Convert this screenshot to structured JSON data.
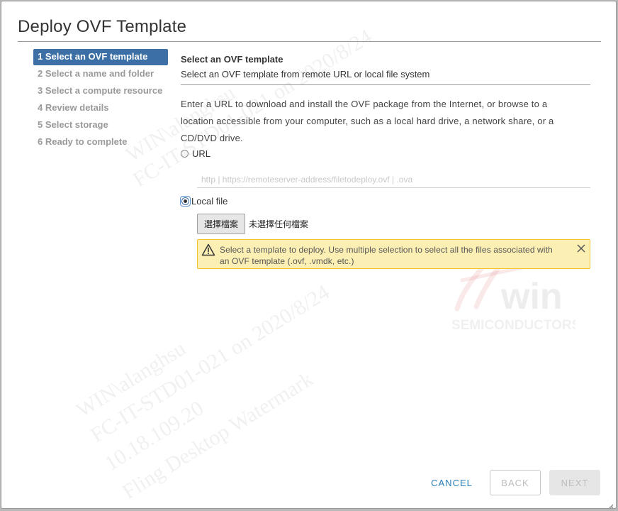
{
  "dialog": {
    "title": "Deploy OVF Template"
  },
  "steps": [
    {
      "label": "1 Select an OVF template",
      "active": true
    },
    {
      "label": "2 Select a name and folder",
      "active": false
    },
    {
      "label": "3 Select a compute resource",
      "active": false
    },
    {
      "label": "4 Review details",
      "active": false
    },
    {
      "label": "5 Select storage",
      "active": false
    },
    {
      "label": "6 Ready to complete",
      "active": false
    }
  ],
  "section": {
    "title": "Select an OVF template",
    "subtitle": "Select an OVF template from remote URL or local file system",
    "description": "Enter a URL to download and install the OVF package from the Internet, or browse to a location accessible from your computer, such as a local hard drive, a network share, or a CD/DVD drive."
  },
  "source": {
    "url_label": "URL",
    "url_placeholder": "http | https://remoteserver-address/filetodeploy.ovf | .ova",
    "url_value": "",
    "local_label": "Local file",
    "selected": "local",
    "file_button_label": "選擇檔案",
    "file_status": "未選擇任何檔案"
  },
  "alert": {
    "text": "Select a template to deploy. Use multiple selection to select all the files associated with an OVF template (.ovf, .vmdk, etc.)",
    "level": "warning"
  },
  "watermark": {
    "lines": [
      "WIN\\alanghsu",
      "FC-IT-STD01-021 on 2020/8/24",
      "10.18.109.20",
      "Fling Desktop Watermark"
    ],
    "logo_text": "win",
    "logo_subtext": "SEMICONDUCTORS"
  },
  "footer": {
    "cancel_label": "CANCEL",
    "back_label": "BACK",
    "next_label": "NEXT"
  },
  "colors": {
    "accent": "#3b6fa6",
    "link": "#2a7fb8",
    "alert_bg": "#fcefb4",
    "alert_border": "#f1c232"
  }
}
